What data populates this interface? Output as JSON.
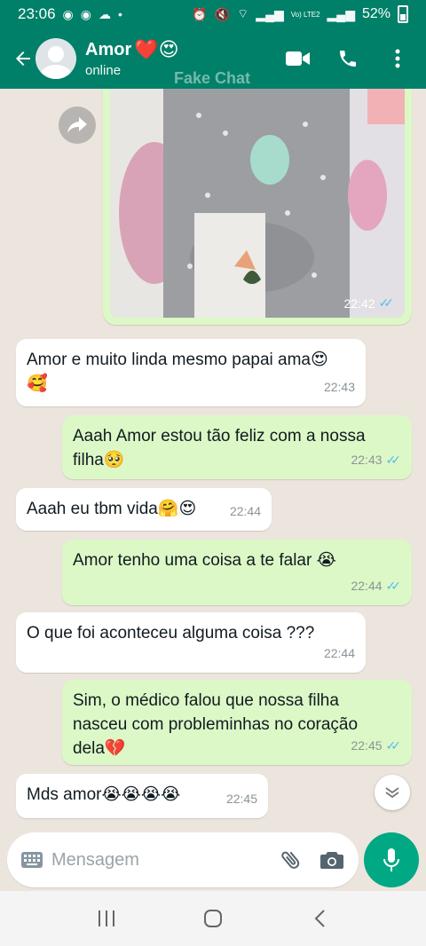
{
  "status_bar": {
    "time": "23:06",
    "battery": "52%",
    "dot": "•",
    "network": "Vo) LTE2"
  },
  "header": {
    "contact_name": "Amor",
    "name_emojis": "❤️😍",
    "status": "online",
    "watermark": "Fake Chat"
  },
  "messages": [
    {
      "direction": "out",
      "type": "image",
      "time": "22:42",
      "read": true
    },
    {
      "direction": "in",
      "line1": "Amor e muito linda mesmo papai ama😍",
      "line2": "🥰",
      "time": "22:43"
    },
    {
      "direction": "out",
      "line1": "Aaah Amor estou tão feliz com a nossa",
      "line2": "filha🥺",
      "time": "22:43",
      "read": true
    },
    {
      "direction": "in",
      "line1": "Aaah eu tbm vida🤗😍",
      "time": "22:44"
    },
    {
      "direction": "out",
      "line1": "Amor tenho uma coisa a te falar 😭",
      "time": "22:44",
      "read": true
    },
    {
      "direction": "in",
      "line1": "O que foi aconteceu alguma coisa ???",
      "time": "22:44"
    },
    {
      "direction": "out",
      "line1": "Sim, o médico falou que nossa filha",
      "line2": "nasceu com probleminhas  no coração",
      "line3": "dela💔",
      "time": "22:45",
      "read": true
    },
    {
      "direction": "in",
      "line1": "Mds amor😭😭😭😭",
      "time": "22:45"
    }
  ],
  "composer": {
    "placeholder": "Mensagem"
  },
  "icons": [
    "back-arrow-icon",
    "avatar",
    "video-call-icon",
    "phone-icon",
    "more-vert-icon",
    "forward-icon",
    "scroll-down-icon",
    "keyboard-icon",
    "attach-icon",
    "camera-icon",
    "mic-icon",
    "recents-icon",
    "home-icon",
    "nav-back-icon"
  ],
  "colors": {
    "header": "#008069",
    "outgoing": "#dcf8c6",
    "incoming": "#ffffff",
    "accent": "#00a884",
    "read_tick": "#53bdeb",
    "chat_bg": "#ece5dd"
  }
}
